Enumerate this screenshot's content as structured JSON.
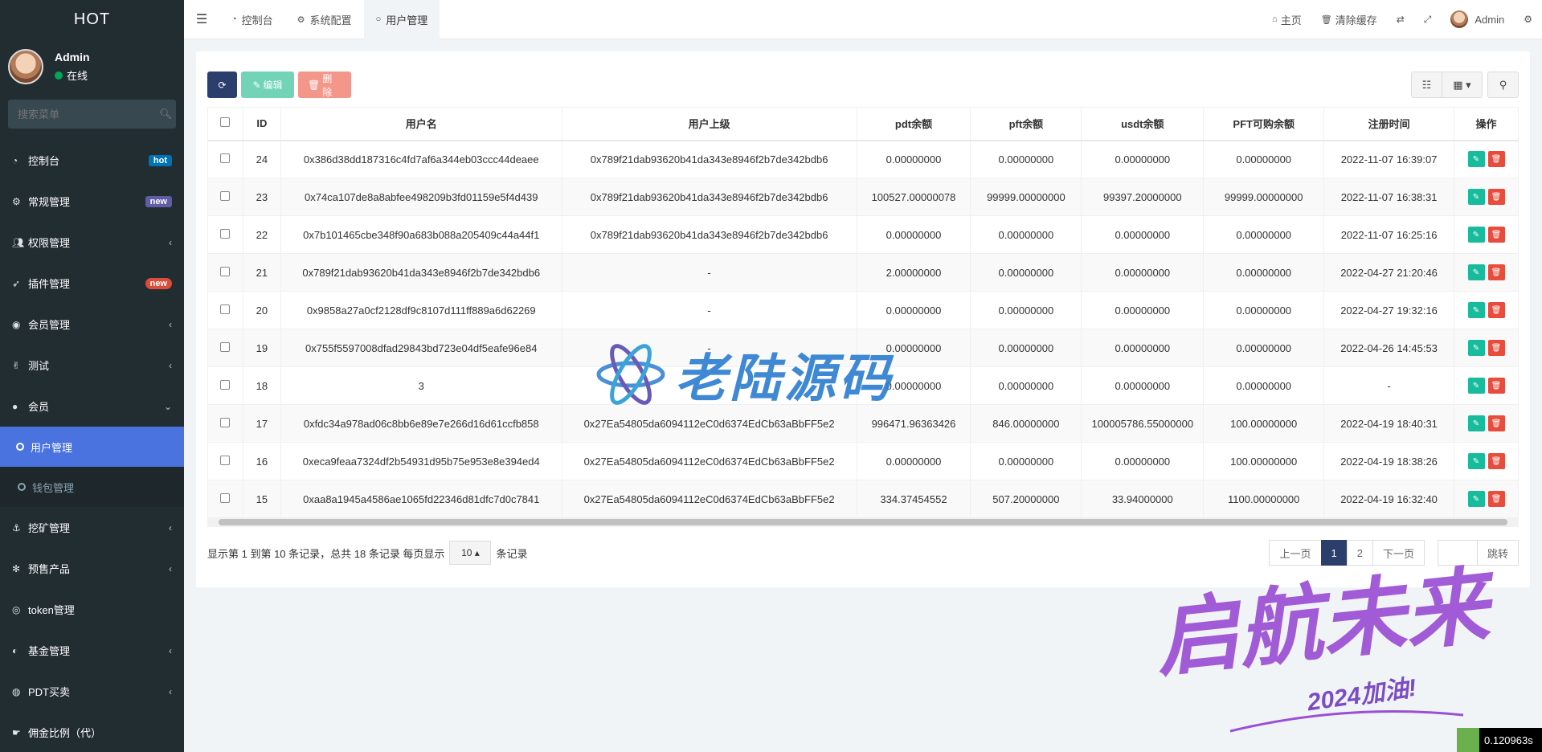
{
  "sidebar": {
    "logo": "HOT",
    "user": {
      "name": "Admin",
      "status": "在线"
    },
    "search_placeholder": "搜索菜单",
    "items": [
      {
        "icon": "dashboard-icon",
        "label": "控制台",
        "badge": "hot"
      },
      {
        "icon": "cogs-icon",
        "label": "常规管理",
        "badge": "new"
      },
      {
        "icon": "group-icon",
        "label": "权限管理",
        "caret": "‹"
      },
      {
        "icon": "rocket-icon",
        "label": "插件管理",
        "badge": "new"
      },
      {
        "icon": "user-circle-icon",
        "label": "会员管理",
        "caret": "‹"
      },
      {
        "icon": "hand-icon",
        "label": "测试",
        "caret": "‹"
      },
      {
        "icon": "user-icon",
        "label": "会员",
        "caret": "⌄"
      }
    ],
    "sub_items": [
      {
        "label": "用户管理"
      },
      {
        "label": "钱包管理"
      }
    ],
    "items_after": [
      {
        "icon": "anchor-icon",
        "label": "挖矿管理",
        "caret": "‹"
      },
      {
        "icon": "yelp-icon",
        "label": "预售产品",
        "caret": "‹"
      },
      {
        "icon": "chrome-icon",
        "label": "token管理"
      },
      {
        "icon": "adjust-icon",
        "label": "基金管理",
        "caret": "‹"
      },
      {
        "icon": "dribbble-icon",
        "label": "PDT买卖",
        "caret": "‹"
      },
      {
        "icon": "hand-point-icon",
        "label": "佣金比例（代）"
      }
    ]
  },
  "header": {
    "tabs": [
      {
        "label": "控制台"
      },
      {
        "label": "系统配置"
      },
      {
        "label": "用户管理"
      }
    ],
    "home": "主页",
    "clear_cache": "清除缓存",
    "admin": "Admin"
  },
  "toolbar": {
    "edit": "编辑",
    "delete": "删除"
  },
  "table": {
    "columns": [
      "ID",
      "用户名",
      "用户上级",
      "pdt余额",
      "pft余额",
      "usdt余额",
      "PFT可购余额",
      "注册时间",
      "操作"
    ],
    "rows": [
      [
        "24",
        "0x386d38dd187316c4fd7af6a344eb03ccc44deaee",
        "0x789f21dab93620b41da343e8946f2b7de342bdb6",
        "0.00000000",
        "0.00000000",
        "0.00000000",
        "0.00000000",
        "2022-11-07 16:39:07"
      ],
      [
        "23",
        "0x74ca107de8a8abfee498209b3fd01159e5f4d439",
        "0x789f21dab93620b41da343e8946f2b7de342bdb6",
        "100527.00000078",
        "99999.00000000",
        "99397.20000000",
        "99999.00000000",
        "2022-11-07 16:38:31"
      ],
      [
        "22",
        "0x7b101465cbe348f90a683b088a205409c44a44f1",
        "0x789f21dab93620b41da343e8946f2b7de342bdb6",
        "0.00000000",
        "0.00000000",
        "0.00000000",
        "0.00000000",
        "2022-11-07 16:25:16"
      ],
      [
        "21",
        "0x789f21dab93620b41da343e8946f2b7de342bdb6",
        "-",
        "2.00000000",
        "0.00000000",
        "0.00000000",
        "0.00000000",
        "2022-04-27 21:20:46"
      ],
      [
        "20",
        "0x9858a27a0cf2128df9c8107d111ff889a6d62269",
        "-",
        "0.00000000",
        "0.00000000",
        "0.00000000",
        "0.00000000",
        "2022-04-27 19:32:16"
      ],
      [
        "19",
        "0x755f5597008dfad29843bd723e04df5eafe96e84",
        "-",
        "0.00000000",
        "0.00000000",
        "0.00000000",
        "0.00000000",
        "2022-04-26 14:45:53"
      ],
      [
        "18",
        "3",
        "",
        "0.00000000",
        "0.00000000",
        "0.00000000",
        "0.00000000",
        "-"
      ],
      [
        "17",
        "0xfdc34a978ad06c8bb6e89e7e266d16d61ccfb858",
        "0x27Ea54805da6094112eC0d6374EdCb63aBbFF5e2",
        "996471.96363426",
        "846.00000000",
        "100005786.55000000",
        "100.00000000",
        "2022-04-19 18:40:31"
      ],
      [
        "16",
        "0xeca9feaa7324df2b54931d95b75e953e8e394ed4",
        "0x27Ea54805da6094112eC0d6374EdCb63aBbFF5e2",
        "0.00000000",
        "0.00000000",
        "0.00000000",
        "100.00000000",
        "2022-04-19 18:38:26"
      ],
      [
        "15",
        "0xaa8a1945a4586ae1065fd22346d81dfc7d0c7841",
        "0x27Ea54805da6094112eC0d6374EdCb63aBbFF5e2",
        "334.37454552",
        "507.20000000",
        "33.94000000",
        "1100.00000000",
        "2022-04-19 16:32:40"
      ]
    ]
  },
  "pagination": {
    "info_prefix": "显示第 1 到第 10 条记录，总共 18 条记录 每页显示",
    "page_size": "10",
    "info_suffix": "条记录",
    "prev": "上一页",
    "pages": [
      "1",
      "2"
    ],
    "next": "下一页",
    "jump": "跳转"
  },
  "watermarks": {
    "brand": "老陆源码",
    "slogan": "启航未来",
    "tag": "2024加油!"
  },
  "perf": "0.120963s",
  "colors": {
    "sidebar": "#222d32",
    "active": "#4a73e0",
    "primary": "#2c3e6b",
    "success": "#18bc9c",
    "danger": "#e74c3c"
  }
}
